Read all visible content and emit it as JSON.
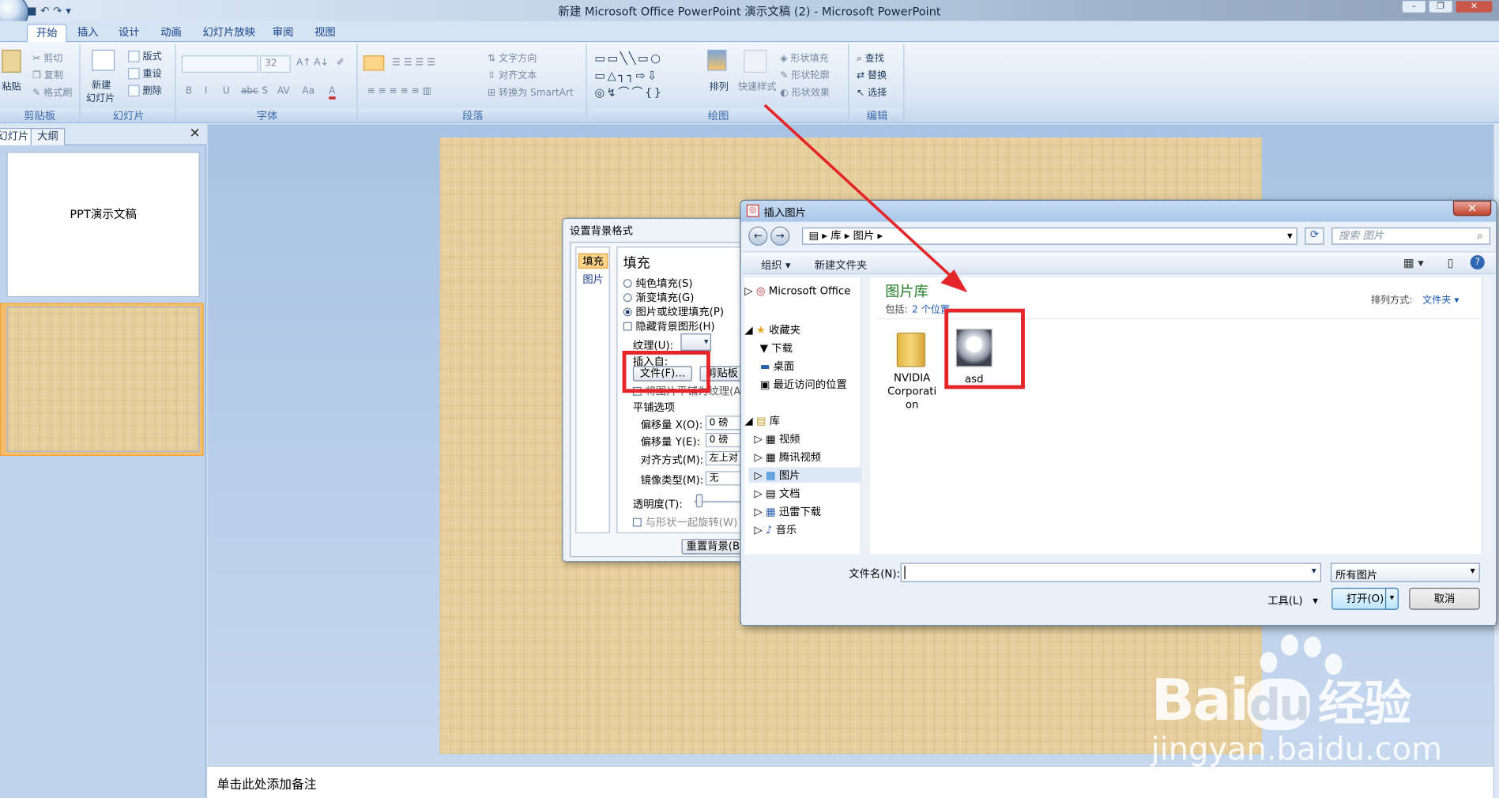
{
  "window": {
    "title": "新建 Microsoft Office PowerPoint 演示文稿 (2) - Microsoft PowerPoint"
  },
  "ribbon": {
    "tabs": [
      "开始",
      "插入",
      "设计",
      "动画",
      "幻灯片放映",
      "审阅",
      "视图"
    ],
    "clipboard": {
      "paste": "粘贴",
      "cut": "剪切",
      "copy": "复制",
      "format_painter": "格式刷",
      "label": "剪贴板"
    },
    "slides": {
      "new_slide_1": "新建",
      "new_slide_2": "幻灯片",
      "layout": "版式",
      "reset": "重设",
      "delete": "删除",
      "label": "幻灯片"
    },
    "font": {
      "size": "32",
      "label": "字体",
      "bold": "B",
      "italic": "I",
      "underline": "U",
      "strike": "abc",
      "shadow": "S",
      "spacing": "AV",
      "case": "Aa",
      "color": "A"
    },
    "paragraph": {
      "text_direction": "文字方向",
      "align_text": "对齐文本",
      "smartart": "转换为 SmartArt",
      "label": "段落"
    },
    "drawing": {
      "arrange": "排列",
      "quick_styles": "快速样式",
      "shape_fill": "形状填充",
      "shape_outline": "形状轮廓",
      "shape_effects": "形状效果",
      "label": "绘图"
    },
    "editing": {
      "find": "查找",
      "replace": "替换",
      "select": "选择",
      "label": "编辑"
    }
  },
  "left_panel": {
    "tab_slides": "幻灯片",
    "tab_outline": "大纲",
    "slide1_title": "PPT演示文稿"
  },
  "notes": {
    "placeholder": "单击此处添加备注"
  },
  "format_bg_dialog": {
    "title": "设置背景格式",
    "nav": [
      "填充",
      "图片"
    ],
    "fill_heading": "填充",
    "options": [
      "纯色填充(S)",
      "渐变填充(G)",
      "图片或纹理填充(P)",
      "隐藏背景图形(H)"
    ],
    "texture_label": "纹理(U):",
    "insert_from": "插入自:",
    "file_button": "文件(F)...",
    "clipboard_button": "剪贴板",
    "tile_check": "将图片平铺为纹理(A)",
    "tile_options": "平铺选项",
    "offset_x": "偏移量 X(O):",
    "offset_x_val": "0 磅",
    "offset_y": "偏移量 Y(E):",
    "offset_y_val": "0 磅",
    "alignment": "对齐方式(M):",
    "alignment_val": "左上对",
    "mirror": "镜像类型(M):",
    "mirror_val": "无",
    "transparency": "透明度(T):",
    "rotate": "与形状一起旋转(W)",
    "reset_button": "重置背景(B)"
  },
  "insert_picture_dialog": {
    "title": "插入图片",
    "breadcrumb": [
      "库",
      "图片"
    ],
    "search_placeholder": "搜索 图片",
    "organize": "组织 ▾",
    "new_folder": "新建文件夹",
    "nav": {
      "microsoft_office": "Microsoft Office",
      "favorites": "收藏夹",
      "downloads": "下载",
      "desktop": "桌面",
      "recent": "最近访问的位置",
      "libraries": "库",
      "videos": "视频",
      "tencent_video": "腾讯视频",
      "pictures": "图片",
      "documents": "文档",
      "thunder": "迅雷下载",
      "music": "音乐"
    },
    "library_title": "图片库",
    "includes": "包括:",
    "locations": "2 个位置",
    "sort_label": "排列方式:",
    "sort_value": "文件夹 ▾",
    "items": [
      {
        "name_lines": [
          "NVIDIA",
          "Corporati",
          "on"
        ]
      },
      {
        "name_lines": [
          "asd"
        ]
      }
    ],
    "filename_label": "文件名(N):",
    "filetype": "所有图片",
    "tools": "工具(L)",
    "open_button": "打开(O)",
    "cancel_button": "取消"
  },
  "watermark": {
    "brand_a": "Bai",
    "brand_b": "du",
    "suffix": "经验",
    "url": "jingyan.baidu.com"
  },
  "colors": {
    "highlight_red": "#e4262a",
    "ribbon_blue": "#d5e3f3",
    "slide_wood": "#e7cf9d"
  }
}
